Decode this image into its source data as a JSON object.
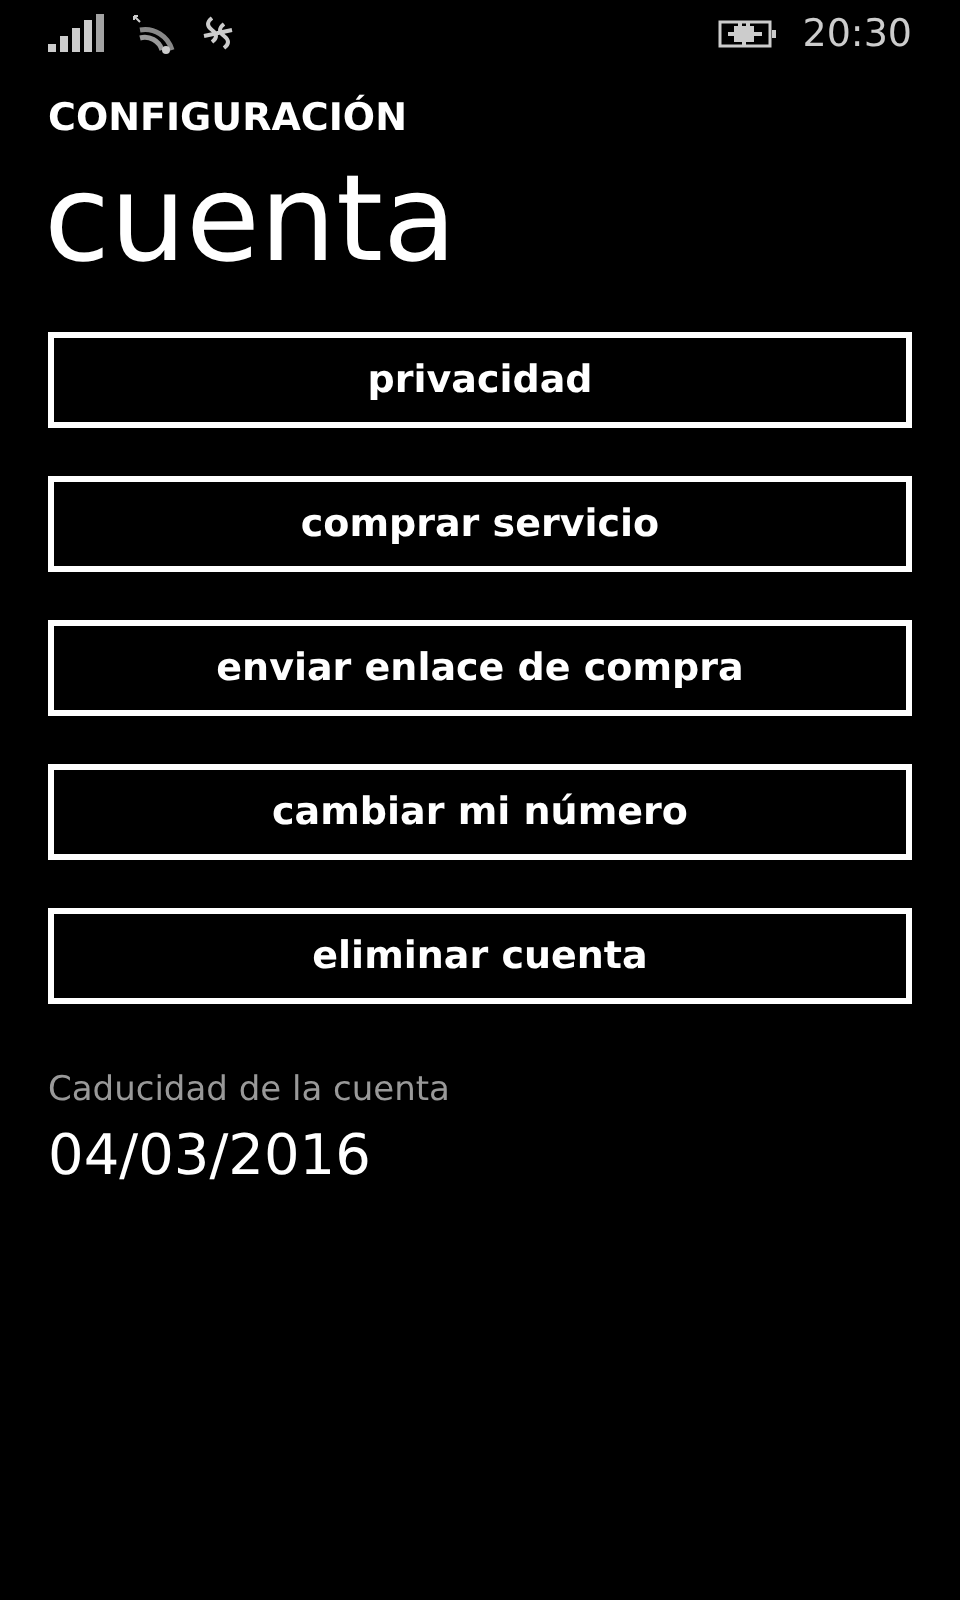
{
  "status_bar": {
    "time": "20:30"
  },
  "app_title": "CONFIGURACIÓN",
  "page_title": "cuenta",
  "buttons": [
    "privacidad",
    "comprar servicio",
    "enviar enlace de compra",
    "cambiar mi número",
    "eliminar cuenta"
  ],
  "expiry": {
    "label": "Caducidad de la cuenta",
    "value": "04/03/2016"
  }
}
